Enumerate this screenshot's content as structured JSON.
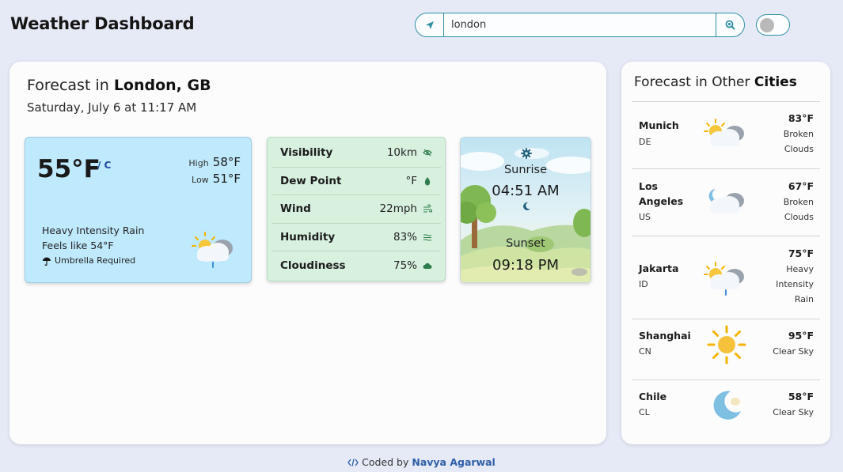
{
  "header": {
    "title": "Weather Dashboard",
    "search": {
      "value": "london",
      "location_icon": "navigation-arrow-icon",
      "search_icon": "magnifier-icon"
    },
    "theme_toggle": {
      "state": "off"
    }
  },
  "current": {
    "heading_prefix": "Forecast in ",
    "location": "London, GB",
    "datetime": "Saturday, July 6 at 11:17 AM",
    "temperature": "55°F",
    "unit_switch": "/ C",
    "high_label": "High",
    "high_value": "58°F",
    "low_label": "Low",
    "low_value": "51°F",
    "condition": "Heavy Intensity Rain",
    "feels_like": "Feels like 54°F",
    "advice": "Umbrella Required",
    "advice_icon": "umbrella-icon",
    "weather_icon": "sun-cloud-rain-icon"
  },
  "details": [
    {
      "label": "Visibility",
      "value": "10km",
      "icon": "eye-slash-icon"
    },
    {
      "label": "Dew Point",
      "value": "°F",
      "icon": "droplet-icon"
    },
    {
      "label": "Wind",
      "value": "22mph",
      "icon": "wind-icon"
    },
    {
      "label": "Humidity",
      "value": "83%",
      "icon": "humidity-lines-icon"
    },
    {
      "label": "Cloudiness",
      "value": "75%",
      "icon": "cloud-icon"
    }
  ],
  "sun": {
    "sunrise_label": "Sunrise",
    "sunrise_time": "04:51 AM",
    "sunset_label": "Sunset",
    "sunset_time": "09:18 PM"
  },
  "other_cities": {
    "heading_prefix": "Forecast in Other ",
    "heading_bold": "Cities",
    "cities": [
      {
        "name": "Munich",
        "country": "DE",
        "temp": "83°F",
        "desc": "Broken Clouds",
        "icon": "sun-cloud-icon"
      },
      {
        "name": "Los Angeles",
        "country": "US",
        "temp": "67°F",
        "desc": "Broken Clouds",
        "icon": "moon-cloud-icon"
      },
      {
        "name": "Jakarta",
        "country": "ID",
        "temp": "75°F",
        "desc": "Heavy Intensity Rain",
        "icon": "sun-cloud-rain-icon"
      },
      {
        "name": "Shanghai",
        "country": "CN",
        "temp": "95°F",
        "desc": "Clear Sky",
        "icon": "sun-icon"
      },
      {
        "name": "Chile",
        "country": "CL",
        "temp": "58°F",
        "desc": "Clear Sky",
        "icon": "moon-icon"
      }
    ]
  },
  "footer": {
    "prefix": "Coded by ",
    "author": "Navya Agarwal",
    "icon": "code-icon"
  },
  "colors": {
    "accent": "#2e8fa3",
    "temp_card": "#bfe9fd",
    "details_card": "#d8f1df",
    "page_bg": "#e6eaf7"
  }
}
